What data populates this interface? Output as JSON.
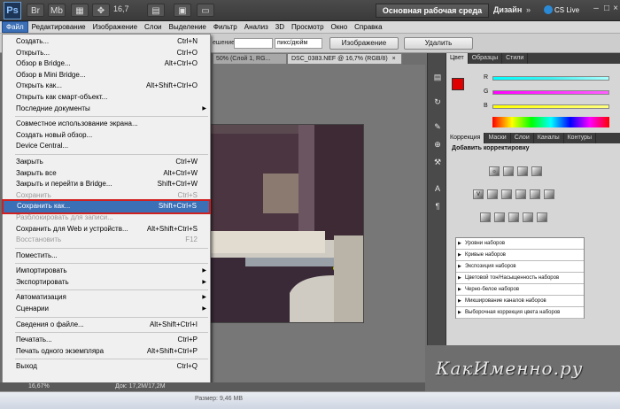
{
  "app": {
    "logo": "Ps",
    "zoom": "16,7",
    "workspace_button": "Основная рабочая среда",
    "design_label": "Дизайн",
    "more": "»",
    "cs_live": "CS Live"
  },
  "menubar": [
    "Файл",
    "Редактирование",
    "Изображение",
    "Слои",
    "Выделение",
    "Фильтр",
    "Анализ",
    "3D",
    "Просмотр",
    "Окно",
    "Справка"
  ],
  "options": {
    "label1": "ешение:",
    "unit": "пикс/дюйм",
    "btn_image": "Изображение",
    "btn_delete": "Удалить"
  },
  "tabs": {
    "tab1": "50% (Слой 1, RG...",
    "tab2": "DSC_0383.NEF @ 16,7% (RGB/8)",
    "close": "×"
  },
  "file_menu": [
    {
      "label": "Создать...",
      "shortcut": "Ctrl+N"
    },
    {
      "label": "Открыть...",
      "shortcut": "Ctrl+O"
    },
    {
      "label": "Обзор в Bridge...",
      "shortcut": "Alt+Ctrl+O"
    },
    {
      "label": "Обзор в Mini Bridge...",
      "shortcut": ""
    },
    {
      "label": "Открыть как...",
      "shortcut": "Alt+Shift+Ctrl+O"
    },
    {
      "label": "Открыть как смарт-объект...",
      "shortcut": ""
    },
    {
      "label": "Последние документы",
      "shortcut": "",
      "submenu": true
    },
    {
      "sep": true
    },
    {
      "label": "Совместное использование экрана...",
      "shortcut": ""
    },
    {
      "label": "Создать новый обзор...",
      "shortcut": ""
    },
    {
      "label": "Device Central...",
      "shortcut": ""
    },
    {
      "sep": true
    },
    {
      "label": "Закрыть",
      "shortcut": "Ctrl+W"
    },
    {
      "label": "Закрыть все",
      "shortcut": "Alt+Ctrl+W"
    },
    {
      "label": "Закрыть и перейти в Bridge...",
      "shortcut": "Shift+Ctrl+W"
    },
    {
      "label": "Сохранить",
      "shortcut": "Ctrl+S",
      "disabled": true
    },
    {
      "label": "Сохранить как...",
      "shortcut": "Shift+Ctrl+S",
      "highlight": true
    },
    {
      "label": "Разблокировать для записи...",
      "shortcut": "",
      "disabled": true
    },
    {
      "label": "Сохранить для Web и устройств...",
      "shortcut": "Alt+Shift+Ctrl+S"
    },
    {
      "label": "Восстановить",
      "shortcut": "F12",
      "disabled": true
    },
    {
      "sep": true
    },
    {
      "label": "Поместить...",
      "shortcut": ""
    },
    {
      "sep": true
    },
    {
      "label": "Импортировать",
      "shortcut": "",
      "submenu": true
    },
    {
      "label": "Экспортировать",
      "shortcut": "",
      "submenu": true
    },
    {
      "sep": true
    },
    {
      "label": "Автоматизация",
      "shortcut": "",
      "submenu": true
    },
    {
      "label": "Сценарии",
      "shortcut": "",
      "submenu": true
    },
    {
      "sep": true
    },
    {
      "label": "Сведения о файле...",
      "shortcut": "Alt+Shift+Ctrl+I"
    },
    {
      "sep": true
    },
    {
      "label": "Печатать...",
      "shortcut": "Ctrl+P"
    },
    {
      "label": "Печать одного экземпляра",
      "shortcut": "Alt+Shift+Ctrl+P"
    },
    {
      "sep": true
    },
    {
      "label": "Выход",
      "shortcut": "Ctrl+Q"
    }
  ],
  "color_panel": {
    "tabs": [
      "Цвет",
      "Образцы",
      "Стили"
    ],
    "r": "R",
    "g": "G",
    "b": "B",
    "fg_color": "#e00000",
    "bg_color": "#ffffff"
  },
  "adj_panel": {
    "tabs": [
      "Коррекция",
      "Маски",
      "Слои",
      "Каналы",
      "Контуры"
    ],
    "title": "Добавить корректировку",
    "presets": [
      "Уровни наборов",
      "Кривые наборов",
      "Экспозиция наборов",
      "Цветовой тон/Насыщенность наборов",
      "Черно-белое наборов",
      "Микширование каналов наборов",
      "Выборочная коррекция цвета наборов"
    ]
  },
  "statusbar": {
    "zoom": "16,67%",
    "doc": "Док: 17,2M/17,2M",
    "size": "Размер: 9,46 MB"
  },
  "watermark": "КакИменно.ру"
}
